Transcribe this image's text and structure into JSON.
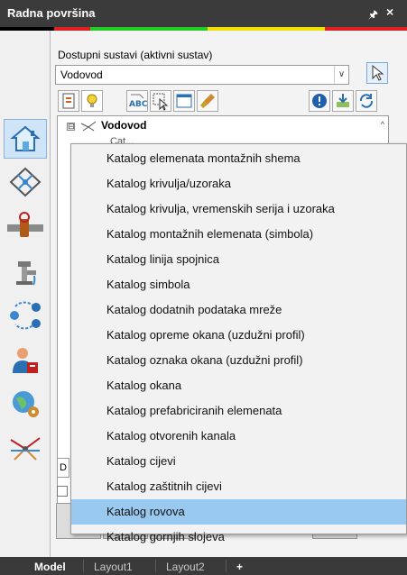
{
  "window": {
    "title": "Radna površina",
    "pin_icon": "pin-icon",
    "close_icon": "close-icon",
    "color_strip": [
      "#000000",
      "#e02020",
      "#22cc22",
      "#f0e000",
      "#e02020"
    ]
  },
  "sidebar": {
    "items": [
      {
        "name": "home-icon",
        "active": true
      },
      {
        "name": "network-diamond-icon"
      },
      {
        "name": "valve-pipe-icon"
      },
      {
        "name": "hydrant-tap-icon"
      },
      {
        "name": "node-graph-icon"
      },
      {
        "name": "user-report-icon"
      },
      {
        "name": "globe-gear-icon"
      },
      {
        "name": "pipe-network-icon"
      }
    ]
  },
  "systems": {
    "label": "Dostupni sustavi (aktivni sustav)",
    "selected": "Vodovod"
  },
  "toolbar": {
    "icons": [
      "catalog-doc-icon",
      "bulb-icon",
      "abc-label-icon",
      "select-cursor-icon",
      "window-icon",
      "brush-icon",
      "info-icon",
      "import-icon",
      "refresh-icon"
    ]
  },
  "tree": {
    "expander": "⊟",
    "root_label": "Vodovod",
    "child_label": "Cat..."
  },
  "bottom": {
    "field_text": "D"
  },
  "menu": {
    "items": [
      "Katalog elemenata montažnih shema",
      "Katalog krivulja/uzoraka",
      "Katalog krivulja, vremenskih serija i uzoraka",
      "Katalog montažnih elemenata (simbola)",
      "Katalog linija spojnica",
      "Katalog simbola",
      "Katalog dodatnih podataka mreže",
      "Katalog opreme okana (uzdužni profil)",
      "Katalog oznaka okana (uzdužni profil)",
      "Katalog okana",
      "Katalog prefabriciranih elemenata",
      "Katalog otvorenih kanala",
      "Katalog cijevi",
      "Katalog zaštitnih cijevi",
      "Katalog rovova",
      "Katalog gornjih slojeva"
    ],
    "selected_index": 14
  },
  "statusbar": {
    "tabs": [
      "Model",
      "Layout1",
      "Layout2",
      "+"
    ]
  }
}
